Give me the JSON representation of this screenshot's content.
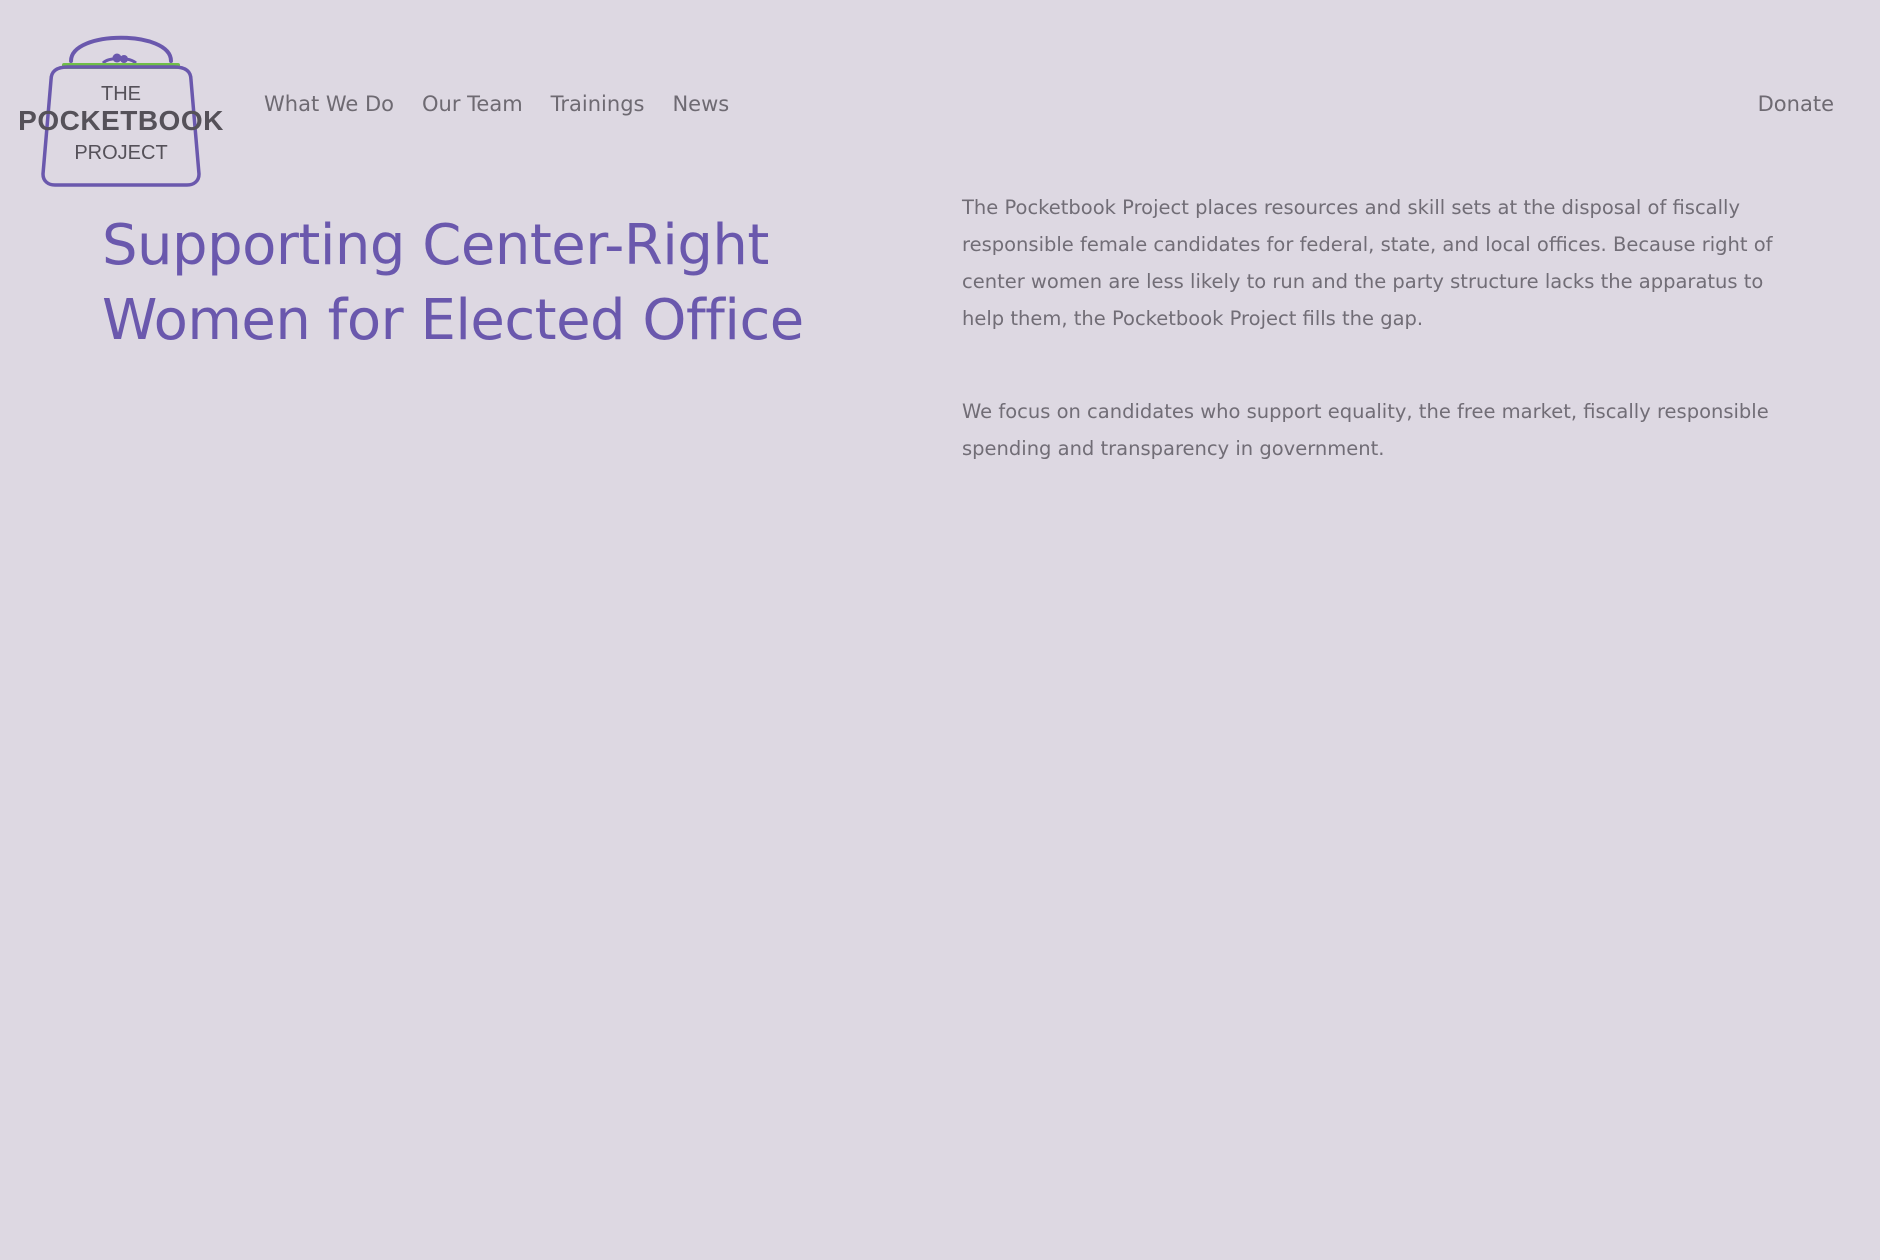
{
  "site": {
    "logo": {
      "line1": "THE",
      "line2": "POCKETBOOK",
      "line3": "PROJECT",
      "icon": "pocketbook-purse-icon"
    },
    "colors": {
      "background": "#ddd8e2",
      "accent_purple": "#6a58ad",
      "accent_green": "#6fbe48",
      "text_gray": "#6e6a72"
    }
  },
  "nav": {
    "items": [
      {
        "label": "What We Do"
      },
      {
        "label": "Our Team"
      },
      {
        "label": "Trainings"
      },
      {
        "label": "News"
      }
    ],
    "donate_label": "Donate"
  },
  "hero": {
    "title_line1": "Supporting Center-Right",
    "title_line2": "Women for Elected Office",
    "paragraph1": "The Pocketbook Project places resources and skill sets at the disposal of fiscally responsible female candidates for federal, state, and local offices.  Because right of center women are less likely to run and the party structure lacks the apparatus to help them, the Pocketbook Project fills the gap.",
    "paragraph2": "We focus on candidates who support equality, the free market, fiscally responsible spending and transparency in government."
  }
}
